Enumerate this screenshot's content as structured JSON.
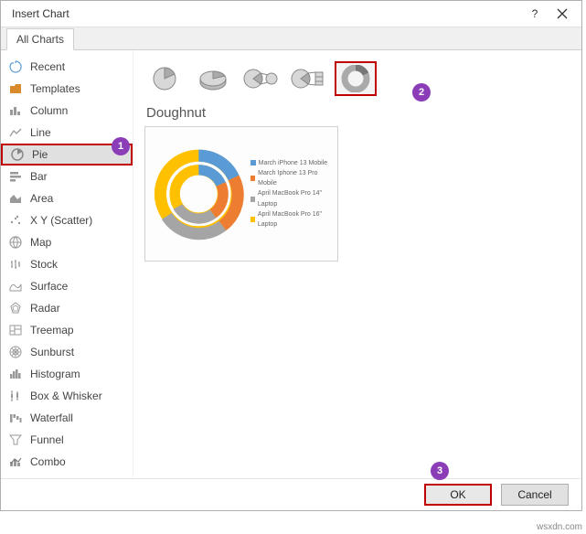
{
  "dialog": {
    "title": "Insert Chart",
    "help_label": "?",
    "close_label": "×"
  },
  "tabs": {
    "all_charts": "All Charts"
  },
  "sidebar": {
    "items": [
      {
        "label": "Recent"
      },
      {
        "label": "Templates"
      },
      {
        "label": "Column"
      },
      {
        "label": "Line"
      },
      {
        "label": "Pie"
      },
      {
        "label": "Bar"
      },
      {
        "label": "Area"
      },
      {
        "label": "X Y (Scatter)"
      },
      {
        "label": "Map"
      },
      {
        "label": "Stock"
      },
      {
        "label": "Surface"
      },
      {
        "label": "Radar"
      },
      {
        "label": "Treemap"
      },
      {
        "label": "Sunburst"
      },
      {
        "label": "Histogram"
      },
      {
        "label": "Box & Whisker"
      },
      {
        "label": "Waterfall"
      },
      {
        "label": "Funnel"
      },
      {
        "label": "Combo"
      }
    ]
  },
  "subtypes": {
    "labels": [
      "pie",
      "3d-pie",
      "pie-of-pie",
      "bar-of-pie",
      "doughnut"
    ],
    "selected_title": "Doughnut"
  },
  "preview_legend": [
    {
      "label": "March iPhone 13 Mobile",
      "color": "#5a9bd5"
    },
    {
      "label": "March Iphone 13 Pro Mobile",
      "color": "#ed7d31"
    },
    {
      "label": "April MacBook Pro 14\" Laptop",
      "color": "#a5a5a5"
    },
    {
      "label": "April MacBook Pro 16\" Laptop",
      "color": "#ffc000"
    }
  ],
  "callouts": {
    "one": "1",
    "two": "2",
    "three": "3"
  },
  "footer": {
    "ok": "OK",
    "cancel": "Cancel"
  },
  "watermark": "wsxdn.com"
}
